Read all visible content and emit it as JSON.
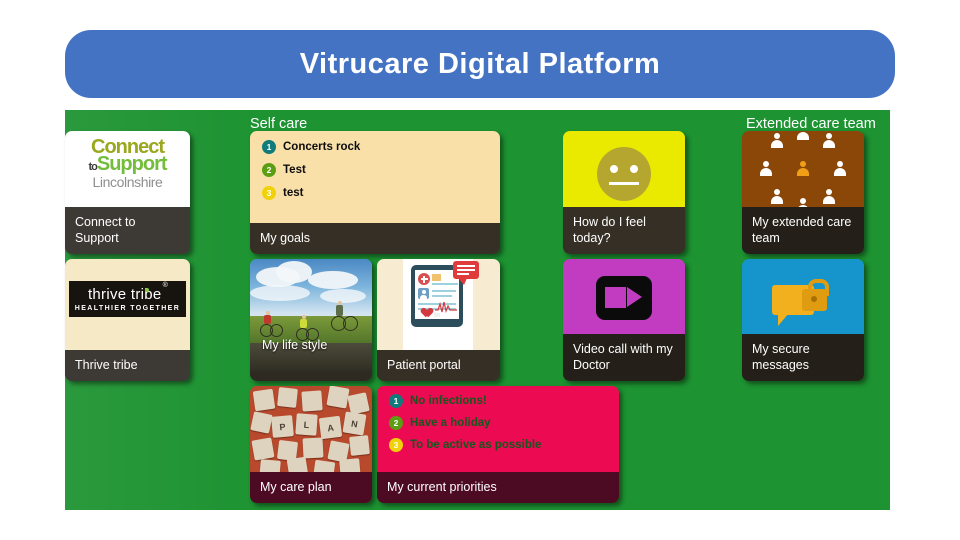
{
  "header": {
    "title": "Vitrucare Digital Platform",
    "bar_color": "#4573c4"
  },
  "board": {
    "background_color": "#1d9331"
  },
  "section_labels": {
    "self_care": "Self care",
    "extended_care_team": "Extended care team"
  },
  "tiles": {
    "connect_to_support": {
      "caption": "Connect to Support",
      "logo": {
        "line1": "Connect",
        "to": "to",
        "line2": "Support",
        "line3": "Lincolnshire"
      }
    },
    "thrive_tribe": {
      "caption": "Thrive tribe",
      "logo": {
        "main": "thrive tribe",
        "registered": "®",
        "sub": "HEALTHIER TOGETHER"
      }
    },
    "my_goals": {
      "caption": "My goals",
      "items": [
        {
          "num": "1",
          "text": "Concerts rock",
          "badge_color": "#0f7b7b"
        },
        {
          "num": "2",
          "text": "Test",
          "badge_color": "#5c9e13"
        },
        {
          "num": "3",
          "text": "test",
          "badge_color": "#efd20a"
        }
      ]
    },
    "my_life_style": {
      "caption": "My life style"
    },
    "patient_portal": {
      "caption": "Patient portal"
    },
    "how_do_i_feel_today": {
      "caption": "How do I feel today?",
      "face": "neutral-face",
      "tile_color": "#eaea00"
    },
    "video_call": {
      "caption": "Video call with my Doctor",
      "tile_color": "#c13cc1"
    },
    "extended_care_team": {
      "caption": "My extended care team",
      "tile_color": "#8a4708"
    },
    "secure_messages": {
      "caption": "My secure messages",
      "tile_color": "#1695cd"
    },
    "my_care_plan": {
      "caption": "My care plan",
      "letters": [
        "P",
        "L",
        "A",
        "N"
      ]
    },
    "my_current_priorities": {
      "caption": "My current priorities",
      "tile_color": "#ec0b52",
      "items": [
        {
          "num": "1",
          "text": "No infections!",
          "badge_color": "#0f7b7b"
        },
        {
          "num": "2",
          "text": "Have a holiday",
          "badge_color": "#5c9e13"
        },
        {
          "num": "3",
          "text": "To be active as possible",
          "badge_color": "#efd20a"
        }
      ]
    }
  }
}
